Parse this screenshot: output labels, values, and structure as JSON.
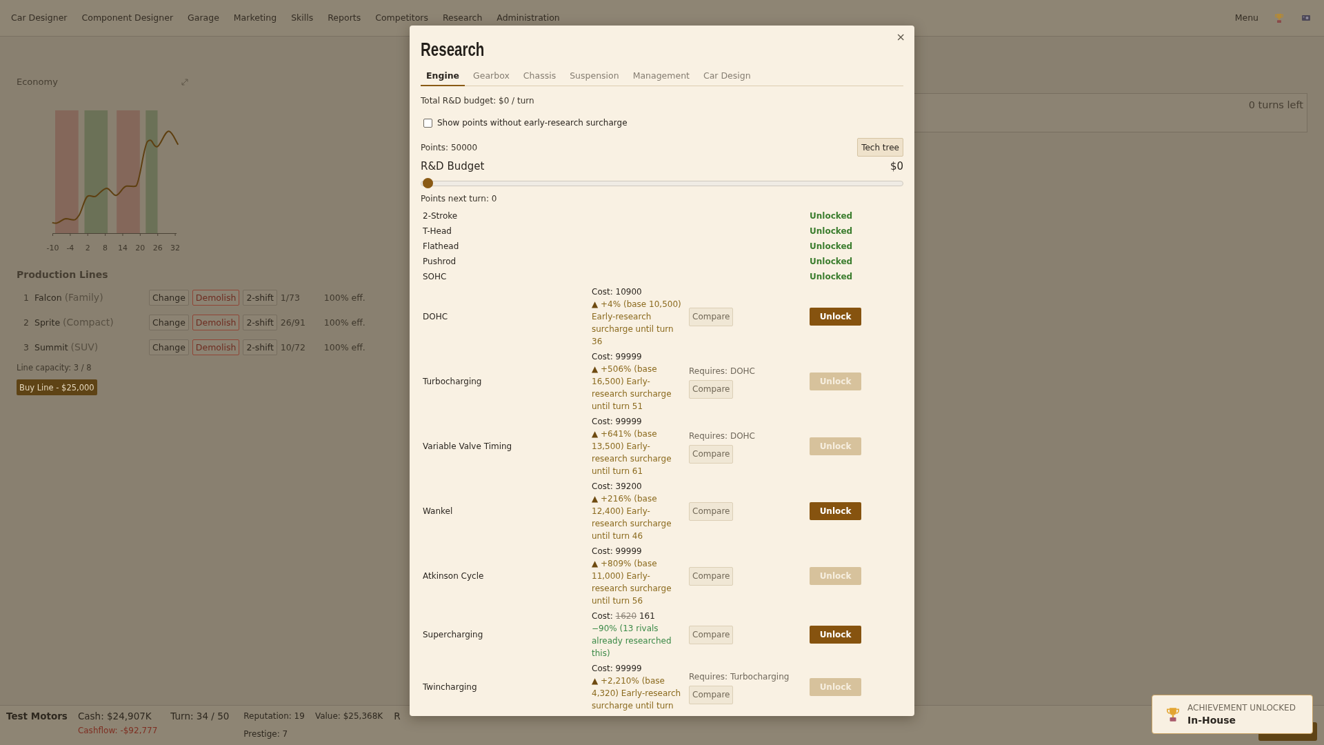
{
  "nav": {
    "items": [
      "Car Designer",
      "Component Designer",
      "Garage",
      "Marketing",
      "Skills",
      "Reports",
      "Competitors",
      "Research",
      "Administration"
    ],
    "menu": "Menu"
  },
  "economy": {
    "title": "Economy",
    "bands": [
      {
        "color": "#84675a"
      },
      {
        "color": "#6b7157"
      },
      {
        "color": "#84675a"
      },
      {
        "color": "#6b7157"
      }
    ],
    "x_ticks": [
      "-10",
      "-4",
      "2",
      "8",
      "14",
      "20",
      "26",
      "32"
    ]
  },
  "production_lines": {
    "title": "Production Lines",
    "rows": [
      {
        "number": "1",
        "name": "Falcon",
        "segment": "(Family)",
        "change": "Change",
        "demolish": "Demolish",
        "shift": "2-shift",
        "output": "1/73",
        "efficiency": "100% eff."
      },
      {
        "number": "2",
        "name": "Sprite",
        "segment": "(Compact)",
        "change": "Change",
        "demolish": "Demolish",
        "shift": "2-shift",
        "output": "26/91",
        "efficiency": "100% eff."
      },
      {
        "number": "3",
        "name": "Summit",
        "segment": "(SUV)",
        "change": "Change",
        "demolish": "Demolish",
        "shift": "2-shift",
        "output": "10/72",
        "efficiency": "100% eff."
      }
    ],
    "capacity": "Line capacity: 3 / 8",
    "buy_button": "Buy Line - $25,000"
  },
  "turns_panel": {
    "text": "0 turns left"
  },
  "research_dialog": {
    "title": "Research",
    "close": "×",
    "tabs": [
      {
        "label": "Engine",
        "selected": true
      },
      {
        "label": "Gearbox",
        "selected": false
      },
      {
        "label": "Chassis",
        "selected": false
      },
      {
        "label": "Suspension",
        "selected": false
      },
      {
        "label": "Management",
        "selected": false
      },
      {
        "label": "Car Design",
        "selected": false
      }
    ],
    "total_budget": "Total R&D budget: $0 / turn",
    "surcharge_toggle": {
      "label": "Show points without early-research surcharge",
      "checked": false
    },
    "points": "Points: 50000",
    "tech_tree_button": "Tech tree",
    "budget": {
      "label": "R&D Budget",
      "reading": "$0",
      "level": 0
    },
    "points_next_turn": "Points next turn: 0",
    "techs": [
      {
        "kind": "unlocked",
        "name": "2-Stroke",
        "status": "Unlocked"
      },
      {
        "kind": "unlocked",
        "name": "T-Head",
        "status": "Unlocked"
      },
      {
        "kind": "unlocked",
        "name": "Flathead",
        "status": "Unlocked"
      },
      {
        "kind": "unlocked",
        "name": "Pushrod",
        "status": "Unlocked"
      },
      {
        "kind": "unlocked",
        "name": "SOHC",
        "status": "Unlocked"
      },
      {
        "kind": "research",
        "name": "DOHC",
        "cost": {
          "label": "Cost:",
          "value": "10900"
        },
        "note": {
          "kind": "surcharge",
          "marker": "▲",
          "text": "+4% (base 10,500) Early-research surcharge until turn 36"
        },
        "compare": "Compare",
        "unlock": {
          "label": "Unlock",
          "disabled": false
        }
      },
      {
        "kind": "research",
        "name": "Turbocharging",
        "cost": {
          "label": "Cost:",
          "value": "99999"
        },
        "note": {
          "kind": "surcharge",
          "marker": "▲",
          "text": "+506% (base 16,500) Early-research surcharge until turn 51"
        },
        "requires": "Requires: DOHC",
        "compare": "Compare",
        "unlock": {
          "label": "Unlock",
          "disabled": true
        }
      },
      {
        "kind": "research",
        "name": "Variable Valve Timing",
        "cost": {
          "label": "Cost:",
          "value": "99999"
        },
        "note": {
          "kind": "surcharge",
          "marker": "▲",
          "text": "+641% (base 13,500) Early-research surcharge until turn 61"
        },
        "requires": "Requires: DOHC",
        "compare": "Compare",
        "unlock": {
          "label": "Unlock",
          "disabled": true
        }
      },
      {
        "kind": "research",
        "name": "Wankel",
        "cost": {
          "label": "Cost:",
          "value": "39200"
        },
        "note": {
          "kind": "surcharge",
          "marker": "▲",
          "text": "+216% (base 12,400) Early-research surcharge until turn 46"
        },
        "compare": "Compare",
        "unlock": {
          "label": "Unlock",
          "disabled": false
        }
      },
      {
        "kind": "research",
        "name": "Atkinson Cycle",
        "cost": {
          "label": "Cost:",
          "value": "99999"
        },
        "note": {
          "kind": "surcharge",
          "marker": "▲",
          "text": "+809% (base 11,000) Early-research surcharge until turn 56"
        },
        "compare": "Compare",
        "unlock": {
          "label": "Unlock",
          "disabled": true
        }
      },
      {
        "kind": "research",
        "name": "Supercharging",
        "cost": {
          "label": "Cost:",
          "old": "1620",
          "value": "161"
        },
        "note": {
          "kind": "discount",
          "text": "−90% (13 rivals already researched this)"
        },
        "compare": "Compare",
        "unlock": {
          "label": "Unlock",
          "disabled": false
        }
      },
      {
        "kind": "research",
        "name": "Twincharging",
        "cost": {
          "label": "Cost:",
          "value": "99999"
        },
        "note": {
          "kind": "surcharge",
          "marker": "▲",
          "text": "+2,210% (base 4,320) Early-research surcharge until turn"
        },
        "requires": "Requires: Turbocharging",
        "compare": "Compare",
        "unlock": {
          "label": "Unlock",
          "disabled": true
        }
      }
    ]
  },
  "status_bar": {
    "company": "Test Motors",
    "cash": "Cash: $24,907K",
    "cashflow": "Cashflow: -$92,777",
    "turn": "Turn: 34 / 50",
    "reputation": "Reputation: 19",
    "prestige": "Prestige: 7",
    "value": "Value: $25,368K",
    "covered_item": "R"
  },
  "achievement_toast": {
    "heading": "ACHIEVEMENT UNLOCKED",
    "title": "In-House"
  }
}
